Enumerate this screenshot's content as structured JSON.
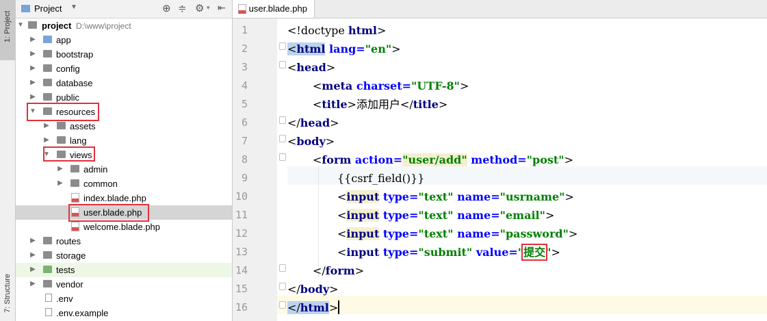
{
  "left_strip": {
    "project_tab": "1: Project",
    "structure_tab": "7: Structure"
  },
  "project_panel": {
    "header_label": "Project",
    "tree": [
      {
        "label": "project",
        "path": "D:\\www\\project",
        "expanded": true,
        "type": "folder"
      },
      {
        "label": "app",
        "type": "folder-blue"
      },
      {
        "label": "bootstrap",
        "type": "folder"
      },
      {
        "label": "config",
        "type": "folder"
      },
      {
        "label": "database",
        "type": "folder"
      },
      {
        "label": "public",
        "type": "folder"
      },
      {
        "label": "resources",
        "expanded": true,
        "type": "folder"
      },
      {
        "label": "assets",
        "type": "folder"
      },
      {
        "label": "lang",
        "type": "folder"
      },
      {
        "label": "views",
        "expanded": true,
        "type": "folder"
      },
      {
        "label": "admin",
        "type": "folder"
      },
      {
        "label": "common",
        "type": "folder"
      },
      {
        "label": "index.blade.php",
        "type": "php"
      },
      {
        "label": "user.blade.php",
        "type": "php",
        "selected": true
      },
      {
        "label": "welcome.blade.php",
        "type": "php"
      },
      {
        "label": "routes",
        "type": "folder"
      },
      {
        "label": "storage",
        "type": "folder"
      },
      {
        "label": "tests",
        "type": "folder-green"
      },
      {
        "label": "vendor",
        "type": "folder"
      },
      {
        "label": ".env",
        "type": "file"
      },
      {
        "label": ".env.example",
        "type": "file"
      }
    ]
  },
  "editor": {
    "tab_label": "user.blade.php",
    "line_numbers": [
      "1",
      "2",
      "3",
      "4",
      "5",
      "6",
      "7",
      "8",
      "9",
      "10",
      "11",
      "12",
      "13",
      "14",
      "15",
      "16"
    ],
    "lines": {
      "l1_open": "<!doctype ",
      "l1_tag": "html",
      "l1_close": ">",
      "l2_open": "<",
      "l2_tag": "html",
      "l2_attr": " lang=",
      "l2_val": "\"en\"",
      "l2_close": ">",
      "l3_open": "<",
      "l3_tag": "head",
      "l3_close": ">",
      "l4_open": "<",
      "l4_tag": "meta",
      "l4_attr": " charset=",
      "l4_val": "\"UTF-8\"",
      "l4_close": ">",
      "l5_open": "<",
      "l5_tag": "title",
      "l5_mid": ">添加用户</",
      "l5_tag2": "title",
      "l5_close": ">",
      "l6_open": "</",
      "l6_tag": "head",
      "l6_close": ">",
      "l7_open": "<",
      "l7_tag": "body",
      "l7_close": ">",
      "l8_open": "<",
      "l8_tag": "form",
      "l8_attr": " action=",
      "l8_val": "\"user/add\"",
      "l8_attr2": " method=",
      "l8_val2": "\"post\"",
      "l8_close": ">",
      "l9": "{{csrf_field()}}",
      "l10_open": "<",
      "l10_tag": "input",
      "l10_attr": " type=",
      "l10_val": "\"text\"",
      "l10_attr2": " name=",
      "l10_val2": "\"usrname\"",
      "l10_close": ">",
      "l11_open": "<",
      "l11_tag": "input",
      "l11_attr": " type=",
      "l11_val": "\"text\"",
      "l11_attr2": " name=",
      "l11_val2": "\"email\"",
      "l11_close": ">",
      "l12_open": "<",
      "l12_tag": "input",
      "l12_attr": " type=",
      "l12_val": "\"text\"",
      "l12_attr2": " name=",
      "l12_val2": "\"password\"",
      "l12_close": ">",
      "l13_open": "<",
      "l13_tag": "input",
      "l13_attr": " type=",
      "l13_val": "\"submit\"",
      "l13_attr2": " value=",
      "l13_q1": "\"",
      "l13_txt": "提交",
      "l13_q2": "\"",
      "l13_close": ">",
      "l14_open": "</",
      "l14_tag": "form",
      "l14_close": ">",
      "l15_open": "</",
      "l15_tag": "body",
      "l15_close": ">",
      "l16_open": "</",
      "l16_tag": "html",
      "l16_close": ">"
    }
  },
  "colors": {
    "highlight_box": "#e0313b",
    "tag": "#000080",
    "attr": "#0000ff",
    "string": "#008000"
  }
}
